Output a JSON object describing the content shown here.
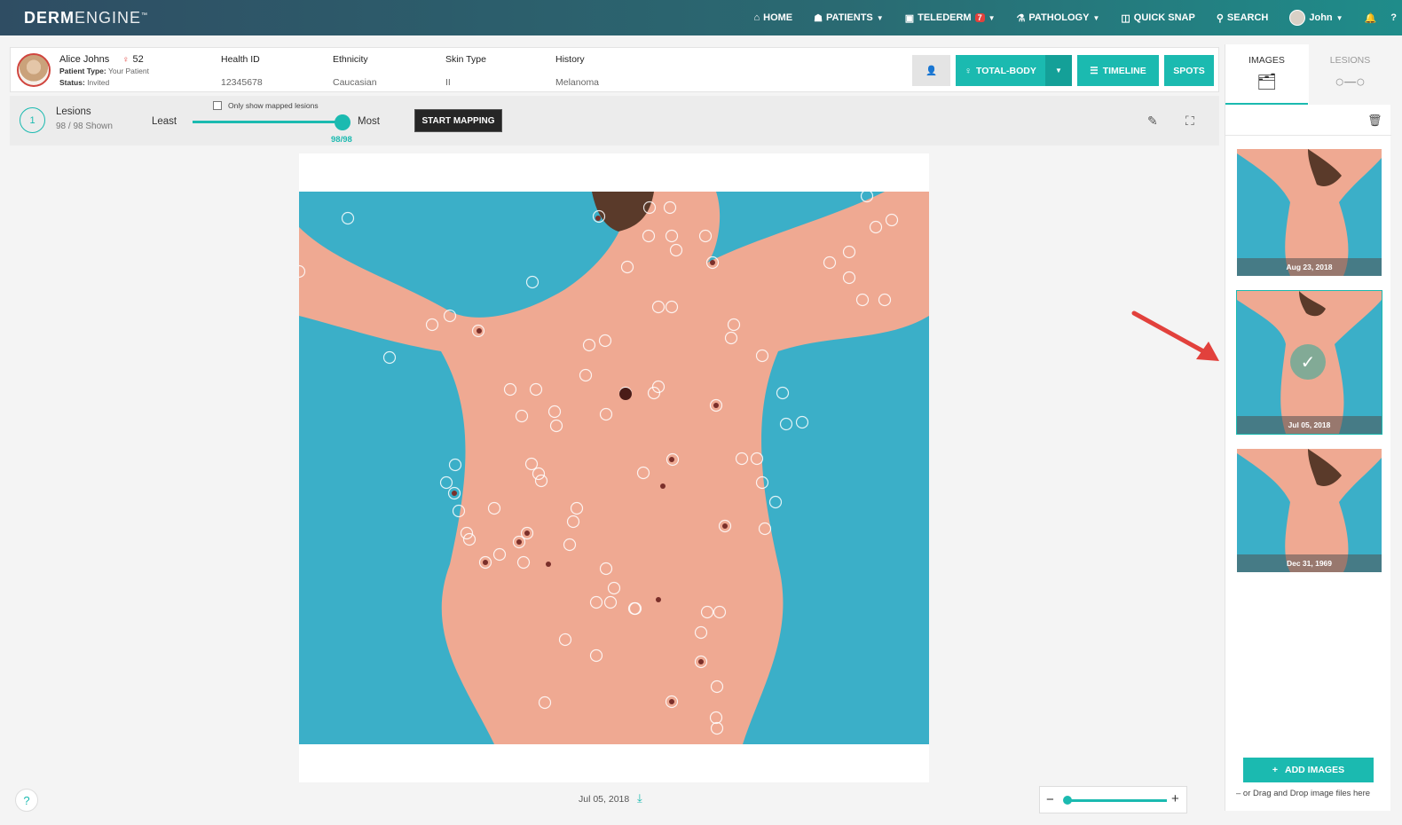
{
  "nav": {
    "brand_bold": "DERM",
    "brand_light": "ENGINE",
    "brand_tm": "™",
    "items": [
      {
        "label": "HOME",
        "icon": "home-icon"
      },
      {
        "label": "PATIENTS",
        "icon": "patients-icon"
      },
      {
        "label": "TELEDERM",
        "icon": "telederm-icon",
        "badge": "7"
      },
      {
        "label": "PATHOLOGY",
        "icon": "microscope-icon"
      },
      {
        "label": "QUICK SNAP",
        "icon": "camera-icon"
      },
      {
        "label": "SEARCH",
        "icon": "search-icon"
      }
    ],
    "user": "John"
  },
  "patient": {
    "name": "Alice Johns",
    "age": "52",
    "type_label": "Patient Type:",
    "type_value": "Your Patient",
    "status_label": "Status:",
    "status_value": "Invited",
    "health_id_label": "Health ID",
    "health_id": "12345678",
    "ethnicity_label": "Ethnicity",
    "ethnicity": "Caucasian",
    "skin_type_label": "Skin Type",
    "skin_type": "II",
    "history_label": "History",
    "history": "Melanoma"
  },
  "actions": {
    "total_body": "TOTAL-BODY",
    "timeline": "TIMELINE",
    "spots": "SPOTS"
  },
  "lesions": {
    "step": "1",
    "title": "Lesions",
    "shown": "98 / 98 Shown",
    "only_mapped_label": "Only show mapped lesions",
    "least": "Least",
    "most": "Most",
    "slider_value": "98/98",
    "slider_fraction": 1.0,
    "start_mapping": "START MAPPING"
  },
  "viewer": {
    "image_date": "Jul 05, 2018",
    "zoom_fraction": 0.0
  },
  "panel": {
    "tab_images": "IMAGES",
    "tab_lesions": "LESIONS",
    "thumbnails": [
      {
        "date": "Aug 23, 2018",
        "selected": false
      },
      {
        "date": "Jul 05, 2018",
        "selected": true
      },
      {
        "date": "Dec 31, 1969",
        "selected": false
      }
    ],
    "add_images": "ADD IMAGES",
    "drag_hint": "– or Drag and Drop image files here"
  },
  "colors": {
    "accent": "#1bbab0",
    "nav_start": "#2f4d63",
    "nav_end": "#1f8c8a",
    "photo_bg": "#3bafc8",
    "skin": "#efa992",
    "arrow": "#e2413c"
  }
}
